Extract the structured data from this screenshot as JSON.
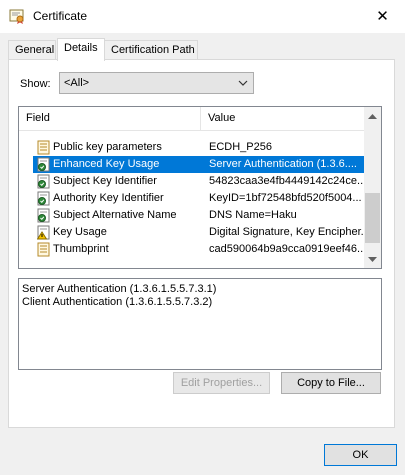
{
  "window": {
    "title": "Certificate",
    "close_label": "✕"
  },
  "tabs": [
    {
      "label": "General"
    },
    {
      "label": "Details"
    },
    {
      "label": "Certification Path"
    }
  ],
  "show": {
    "label": "Show:",
    "value": "<All>"
  },
  "list": {
    "columns": [
      "Field",
      "Value"
    ],
    "rows": [
      {
        "field": "Public key parameters",
        "value": "ECDH_P256",
        "icon": "document-icon"
      },
      {
        "field": "Enhanced Key Usage",
        "value": "Server Authentication (1.3.6....",
        "icon": "extension-icon",
        "selected": true
      },
      {
        "field": "Subject Key Identifier",
        "value": "54823caa3e4fb4449142c24ce...",
        "icon": "extension-icon"
      },
      {
        "field": "Authority Key Identifier",
        "value": "KeyID=1bf72548bfd520f5004...",
        "icon": "extension-icon"
      },
      {
        "field": "Subject Alternative Name",
        "value": "DNS Name=Haku",
        "icon": "extension-icon"
      },
      {
        "field": "Key Usage",
        "value": "Digital Signature, Key Encipher...",
        "icon": "warning-icon"
      },
      {
        "field": "Thumbprint",
        "value": "cad590064b9a9cca0919eef46...",
        "icon": "document-icon"
      }
    ]
  },
  "details": {
    "lines": [
      "Server Authentication (1.3.6.1.5.5.7.3.1)",
      "Client Authentication (1.3.6.1.5.5.7.3.2)"
    ]
  },
  "buttons": {
    "edit_properties": "Edit Properties...",
    "copy_to_file": "Copy to File...",
    "ok": "OK"
  },
  "colors": {
    "selection": "#0078d7",
    "background": "#f0f0f0"
  }
}
